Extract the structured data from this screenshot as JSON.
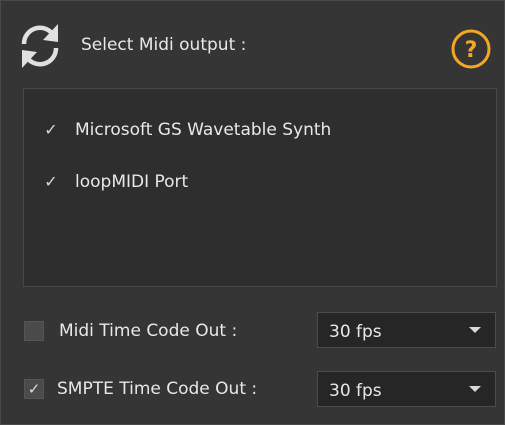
{
  "header": {
    "title": "Select Midi output :",
    "refresh_icon": "refresh-icon",
    "help_icon": "help-icon",
    "help_glyph": "?",
    "accent_color": "#f5a623"
  },
  "midi_outputs": [
    {
      "label": "Microsoft GS Wavetable Synth",
      "checked": true,
      "check_glyph": "✓"
    },
    {
      "label": "loopMIDI Port",
      "checked": true,
      "check_glyph": "✓"
    }
  ],
  "options": {
    "mtc_out": {
      "label": "Midi Time Code Out :",
      "checked": false,
      "check_glyph": "",
      "fps": "30 fps"
    },
    "smpte_out": {
      "label": "SMPTE Time Code Out :",
      "checked": true,
      "check_glyph": "✓",
      "fps": "30 fps"
    }
  },
  "colors": {
    "panel_bg": "#353535",
    "list_bg": "#2e2e2e",
    "select_bg": "#262626",
    "text": "#e8e8e8"
  }
}
